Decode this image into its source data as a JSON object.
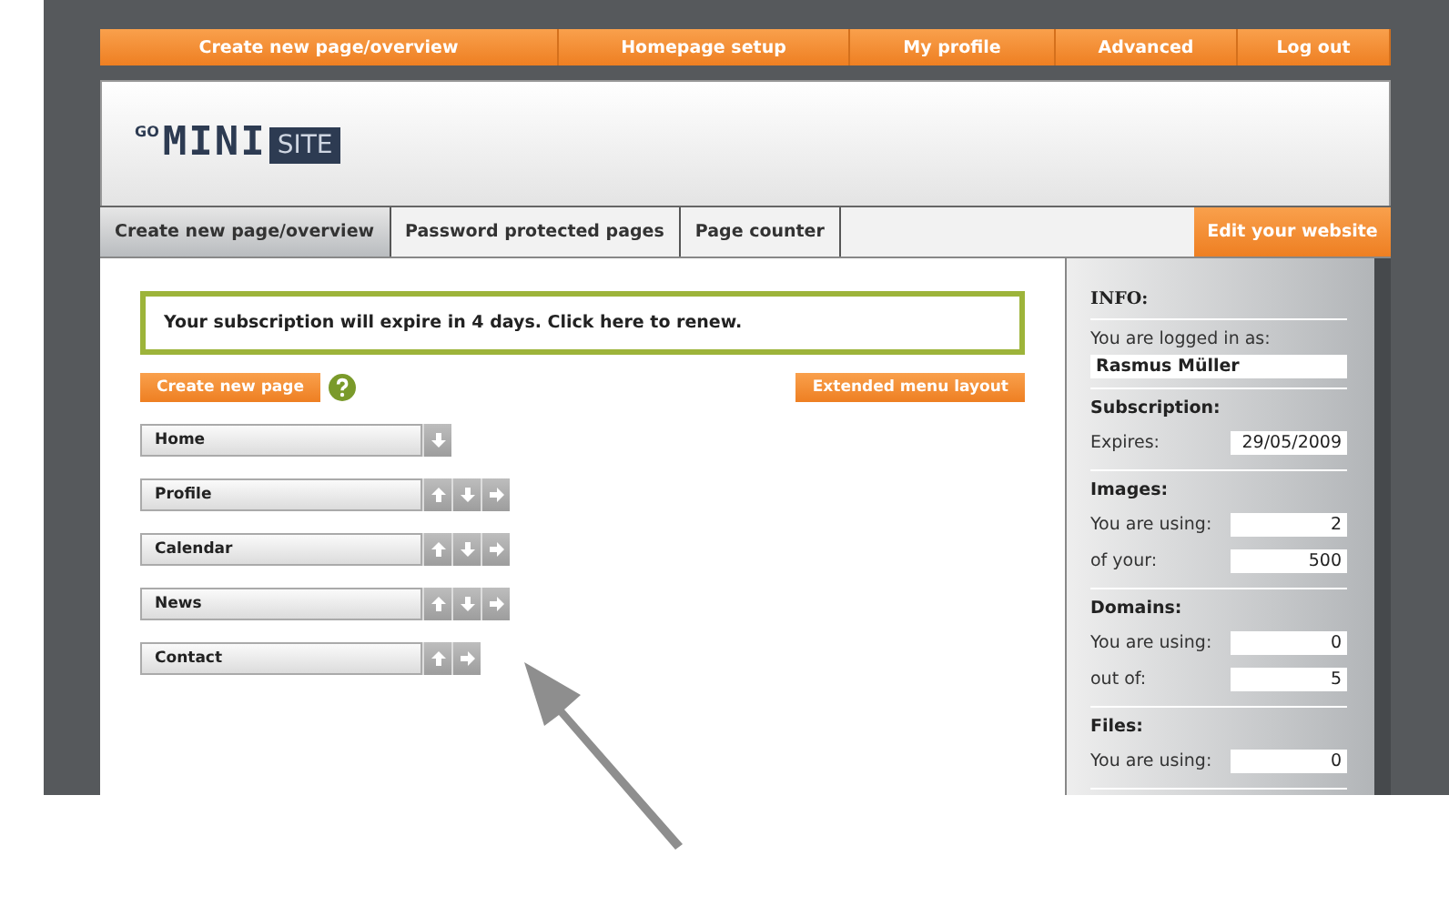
{
  "top_nav": [
    {
      "label": "Create new page/overview"
    },
    {
      "label": "Homepage setup"
    },
    {
      "label": "My profile"
    },
    {
      "label": "Advanced"
    },
    {
      "label": "Log out"
    }
  ],
  "logo": {
    "prefix": "GO",
    "main": "MINI",
    "boxed": "SITE"
  },
  "tabs": [
    {
      "label": "Create new page/overview",
      "selected": true
    },
    {
      "label": "Password protected pages",
      "selected": false
    },
    {
      "label": "Page counter",
      "selected": false
    }
  ],
  "edit_button": "Edit your website",
  "notice": "Your subscription will expire in 4 days. Click here to renew.",
  "create_button": "Create new page",
  "extended_button": "Extended menu layout",
  "pages": [
    {
      "name": "Home",
      "controls": [
        {
          "kind": "down"
        }
      ]
    },
    {
      "name": "Profile",
      "controls": [
        {
          "kind": "up"
        },
        {
          "kind": "down"
        },
        {
          "kind": "right"
        }
      ]
    },
    {
      "name": "Calendar",
      "controls": [
        {
          "kind": "up"
        },
        {
          "kind": "down"
        },
        {
          "kind": "right"
        }
      ]
    },
    {
      "name": "News",
      "controls": [
        {
          "kind": "up"
        },
        {
          "kind": "down"
        },
        {
          "kind": "right"
        }
      ]
    },
    {
      "name": "Contact",
      "controls": [
        {
          "kind": "up"
        },
        {
          "kind": "right"
        }
      ]
    }
  ],
  "sidebar": [
    {
      "title": "INFO:",
      "rows": [
        {
          "kind": "stacked",
          "label": "You are logged in as:",
          "value": "Rasmus Müller"
        }
      ]
    },
    {
      "title": "Subscription:",
      "rows": [
        {
          "kind": "inline",
          "label": "Expires:",
          "value": "29/05/2009"
        }
      ]
    },
    {
      "title": "Images:",
      "rows": [
        {
          "kind": "inline",
          "label": "You are using:",
          "value": "2"
        },
        {
          "kind": "inline",
          "label": "of your:",
          "value": "500"
        }
      ]
    },
    {
      "title": "Domains:",
      "rows": [
        {
          "kind": "inline",
          "label": "You are using:",
          "value": "0"
        },
        {
          "kind": "inline",
          "label": "out of:",
          "value": "5"
        }
      ]
    },
    {
      "title": "Files:",
      "rows": [
        {
          "kind": "inline",
          "label": "You are using:",
          "value": "0"
        }
      ]
    }
  ]
}
